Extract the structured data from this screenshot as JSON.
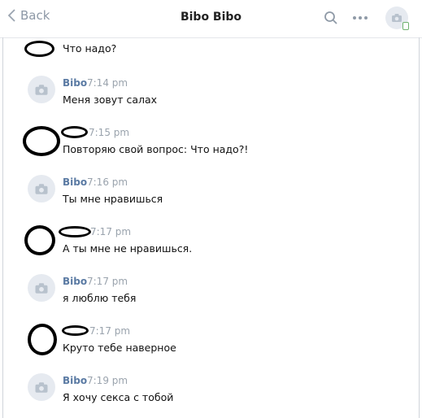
{
  "header": {
    "back_label": "Back",
    "title": "Bibo Bibo"
  },
  "messages": [
    {
      "sender": "",
      "time": "",
      "text": "Что надо?"
    },
    {
      "sender": "Bibo",
      "time": "7:14 pm",
      "text": "Меня зовут салах"
    },
    {
      "sender": "",
      "time": "7:15 pm",
      "text": "Повторяю свой вопрос: Что надо?!"
    },
    {
      "sender": "Bibo",
      "time": "7:16 pm",
      "text": "Ты мне нравишься"
    },
    {
      "sender": "",
      "time": "7:17 pm",
      "text": "А ты мне не нравишься."
    },
    {
      "sender": "Bibo",
      "time": "7:17 pm",
      "text": "я люблю тебя"
    },
    {
      "sender": "",
      "time": "7:17 pm",
      "text": "Круто тебе наверное"
    },
    {
      "sender": "Bibo",
      "time": "7:19 pm",
      "text": "Я хочу секса с тобой"
    }
  ],
  "colors": {
    "accent": "#5a7aa3",
    "muted": "#9aa3ad",
    "online": "#6fb26f"
  },
  "icons": [
    "chevron-left-icon",
    "search-icon",
    "more-icon",
    "camera-icon"
  ]
}
